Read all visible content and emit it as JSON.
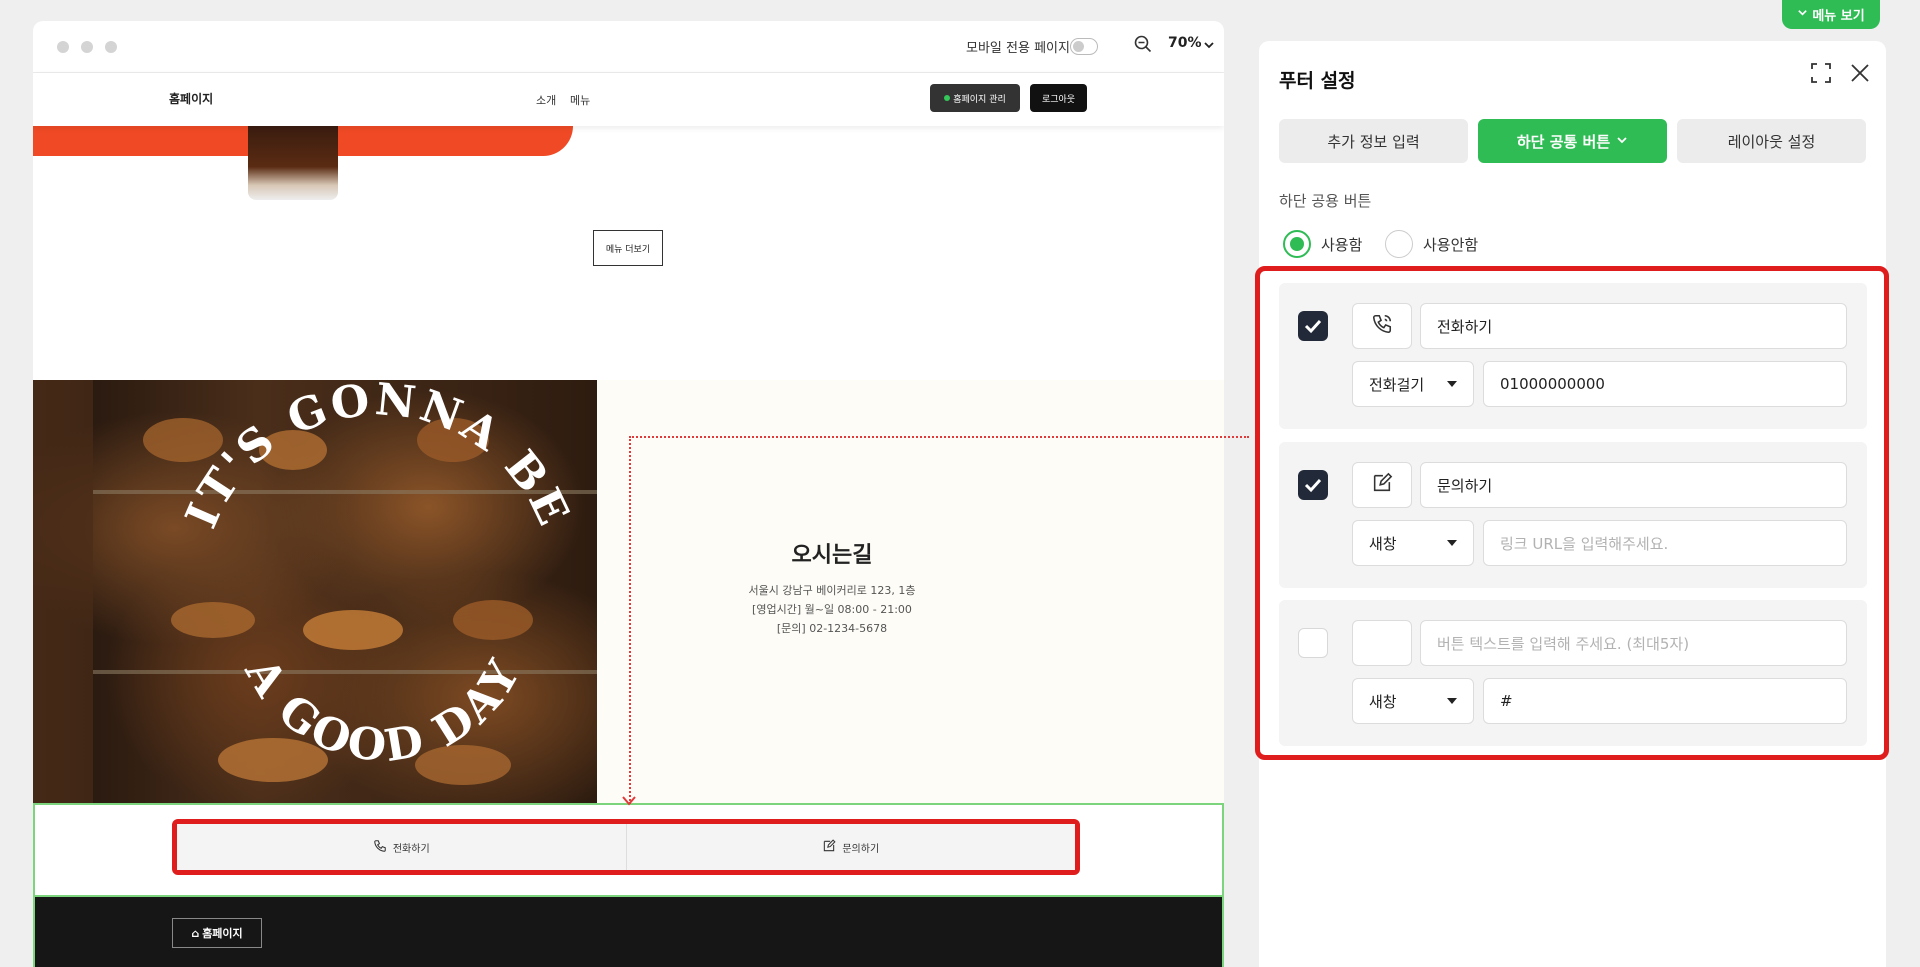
{
  "preview": {
    "mobile_only_label": "모바일 전용 페이지",
    "zoom": "70%",
    "site": {
      "logo": "홈페이지",
      "nav": [
        "소개",
        "메뉴"
      ],
      "admin_button": "홈페이지 관리",
      "logout_button": "로그아웃",
      "more_menu_button": "메뉴 더보기",
      "photo_text_top": "IT'S GONNA BE",
      "photo_text_bottom": "A GOOD DAY",
      "directions": {
        "title": "오시는길",
        "address": "서울시 강남구 베이커리로 123, 1층",
        "hours": "[영업시간] 월~일 08:00 - 21:00",
        "contact": "[문의] 02-1234-5678"
      },
      "footer_buttons": [
        {
          "label": "전화하기",
          "icon": "phone-icon"
        },
        {
          "label": "문의하기",
          "icon": "edit-icon"
        }
      ],
      "footer_logo": "홈페이지"
    }
  },
  "menu_toggle": "메뉴 보기",
  "panel": {
    "title": "푸터 설정",
    "tabs": [
      {
        "label": "추가 정보 입력",
        "active": false
      },
      {
        "label": "하단 공통 버튼",
        "active": true
      },
      {
        "label": "레이아웃 설정",
        "active": false
      }
    ],
    "section_label": "하단 공용 버튼",
    "radio": {
      "use": "사용함",
      "not_use": "사용안함",
      "selected": "use"
    },
    "buttons": [
      {
        "checked": true,
        "icon": "phone-icon",
        "text": "전화하기",
        "text_placeholder": "",
        "action": "전화걸기",
        "value": "01000000000",
        "value_placeholder": ""
      },
      {
        "checked": true,
        "icon": "edit-icon",
        "text": "문의하기",
        "text_placeholder": "",
        "action": "새창",
        "value": "",
        "value_placeholder": "링크 URL을 입력해주세요."
      },
      {
        "checked": false,
        "icon": "",
        "text": "",
        "text_placeholder": "버튼 텍스트를 입력해 주세요. (최대5자)",
        "action": "새창",
        "value": "#",
        "value_placeholder": ""
      }
    ]
  },
  "colors": {
    "accent": "#2fbc55",
    "highlight": "#e01d1d",
    "hero": "#ef4a25",
    "checkbox": "#222a3a"
  }
}
